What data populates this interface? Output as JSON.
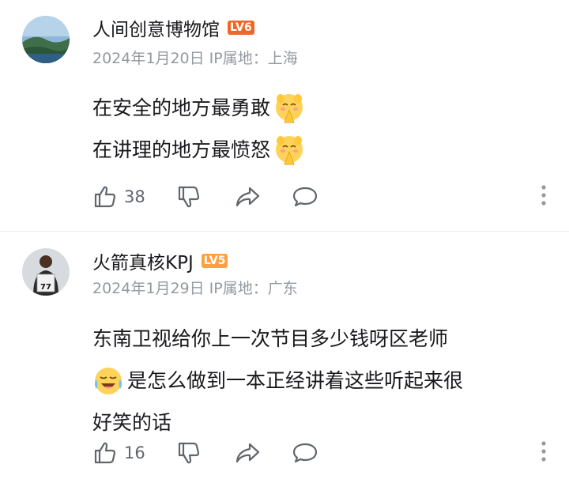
{
  "comments": [
    {
      "username": "人间创意博物馆",
      "level": "LV6",
      "level_color": "#ee672a",
      "date": "2024年1月20日",
      "ip_label": "IP属地：上海",
      "lines": [
        "在安全的地方最勇敢",
        "在讲理的地方最愤怒"
      ],
      "line_emojis": [
        "doge-pray-emoji",
        "doge-pray-emoji"
      ],
      "likes": "38"
    },
    {
      "username": "火箭真核KPJ",
      "level": "LV5",
      "level_color": "#ff9f3e",
      "date": "2024年1月29日",
      "ip_label": "IP属地：广东",
      "line1": "东南卫视给你上一次节目多少钱呀区老师",
      "line2": "是怎么做到一本正经讲着这些听起来很",
      "line3": "好笑的话",
      "inline_emoji": "laugh-cry-emoji",
      "likes": "16"
    }
  ],
  "icons": {
    "like": "thumb-up-icon",
    "dislike": "thumb-down-icon",
    "share": "share-icon",
    "reply": "reply-icon",
    "more": "more-vertical-icon"
  },
  "colors": {
    "text": "#18191c",
    "meta": "#9499a0",
    "icon": "#61666d"
  }
}
